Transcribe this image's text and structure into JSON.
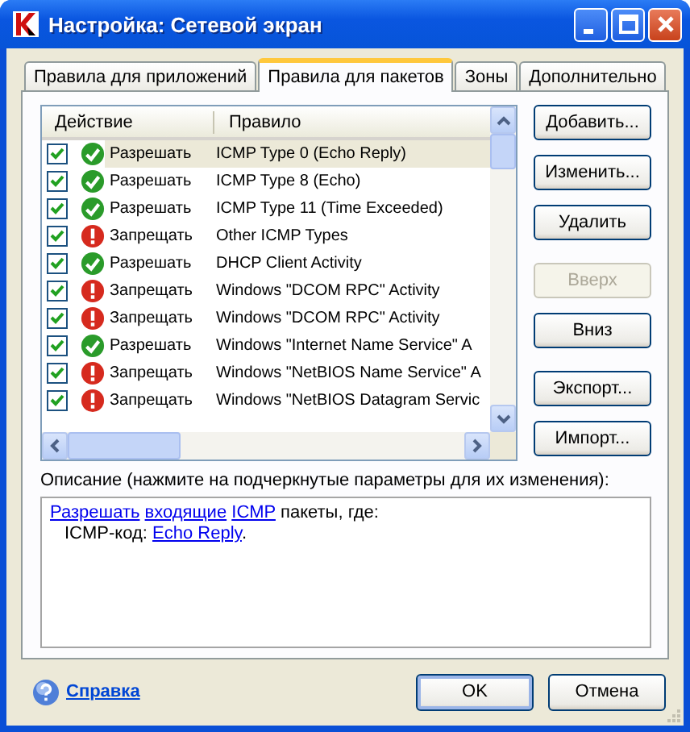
{
  "window": {
    "title": "Настройка: Сетевой экран"
  },
  "tabs": [
    {
      "label": "Правила для приложений",
      "selected": false
    },
    {
      "label": "Правила для пакетов",
      "selected": true
    },
    {
      "label": "Зоны",
      "selected": false
    },
    {
      "label": "Дополнительно",
      "selected": false
    }
  ],
  "table": {
    "columns": [
      "Действие",
      "Правило"
    ],
    "rows": [
      {
        "checked": true,
        "kind": "allow",
        "action": "Разрешать",
        "rule": "ICMP Type 0 (Echo Reply)",
        "selected": true
      },
      {
        "checked": true,
        "kind": "allow",
        "action": "Разрешать",
        "rule": "ICMP Type 8 (Echo)",
        "selected": false
      },
      {
        "checked": true,
        "kind": "allow",
        "action": "Разрешать",
        "rule": "ICMP Type 11 (Time Exceeded)",
        "selected": false
      },
      {
        "checked": true,
        "kind": "deny",
        "action": "Запрещать",
        "rule": "Other ICMP Types",
        "selected": false
      },
      {
        "checked": true,
        "kind": "allow",
        "action": "Разрешать",
        "rule": "DHCP Client Activity",
        "selected": false
      },
      {
        "checked": true,
        "kind": "deny",
        "action": "Запрещать",
        "rule": "Windows \"DCOM RPC\" Activity",
        "selected": false
      },
      {
        "checked": true,
        "kind": "deny",
        "action": "Запрещать",
        "rule": "Windows \"DCOM RPC\" Activity",
        "selected": false
      },
      {
        "checked": true,
        "kind": "allow",
        "action": "Разрешать",
        "rule": "Windows \"Internet Name Service\" A",
        "selected": false
      },
      {
        "checked": true,
        "kind": "deny",
        "action": "Запрещать",
        "rule": "Windows \"NetBIOS Name Service\" A",
        "selected": false
      },
      {
        "checked": true,
        "kind": "deny",
        "action": "Запрещать",
        "rule": "Windows \"NetBIOS Datagram Servic",
        "selected": false
      }
    ]
  },
  "side_buttons": [
    {
      "label": "Добавить...",
      "disabled": false
    },
    {
      "label": "Изменить...",
      "disabled": false
    },
    {
      "label": "Удалить",
      "disabled": false
    },
    {
      "label": "Вверх",
      "disabled": true
    },
    {
      "label": "Вниз",
      "disabled": false
    },
    {
      "label": "Экспорт...",
      "disabled": false
    },
    {
      "label": "Импорт...",
      "disabled": false
    }
  ],
  "description": {
    "label": "Описание (нажмите на подчеркнутые параметры для их изменения):",
    "lines": [
      [
        {
          "text": "Разрешать",
          "link": true,
          "space_after": true
        },
        {
          "text": "входящие",
          "link": true,
          "space_after": true
        },
        {
          "text": "ICMP",
          "link": true,
          "space_after": false
        },
        {
          "text": " пакеты, где:",
          "link": false,
          "space_after": false
        }
      ],
      [
        {
          "text": "ICMP-код:",
          "link": false,
          "space_after": true
        },
        {
          "text": "Echo Reply",
          "link": true,
          "space_after": false
        },
        {
          "text": ".",
          "link": false,
          "space_after": false
        }
      ]
    ]
  },
  "help_link": "Справка",
  "buttons": [
    {
      "label": "OK",
      "default": true
    },
    {
      "label": "Отмена",
      "default": false
    }
  ]
}
